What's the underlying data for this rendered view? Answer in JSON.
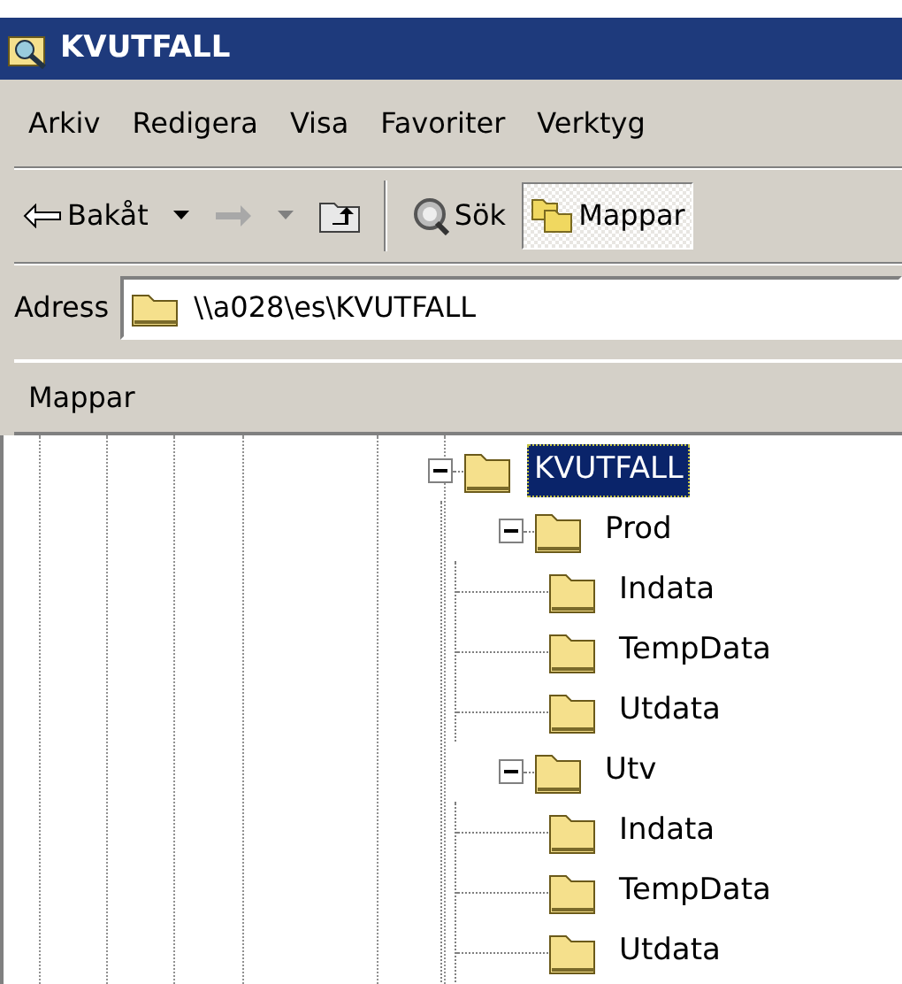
{
  "window": {
    "title": "KVUTFALL"
  },
  "menu": [
    "Arkiv",
    "Redigera",
    "Visa",
    "Favoriter",
    "Verktyg"
  ],
  "toolbar": [
    {
      "kind": "back",
      "label": "Bakåt",
      "disabled": false
    },
    {
      "kind": "forward",
      "disabled": true
    },
    {
      "kind": "up"
    },
    {
      "kind": "search",
      "label": "Sök",
      "selected": false
    },
    {
      "kind": "folders",
      "label": "Mappar",
      "selected": true
    }
  ],
  "address": {
    "label": "Adress",
    "value": "\\\\a028\\es\\KVUTFALL"
  },
  "panel": {
    "title": "Mappar"
  },
  "tree": [
    {
      "label": "KVUTFALL",
      "expanded": true,
      "selected": true,
      "children": [
        {
          "label": "Prod",
          "expanded": true,
          "selected": false,
          "children": [
            {
              "label": "Indata",
              "selected": false
            },
            {
              "label": "TempData",
              "selected": false
            },
            {
              "label": "Utdata",
              "selected": false
            }
          ]
        },
        {
          "label": "Utv",
          "expanded": true,
          "selected": false,
          "children": [
            {
              "label": "Indata",
              "selected": false
            },
            {
              "label": "TempData",
              "selected": false
            },
            {
              "label": "Utdata",
              "selected": false
            }
          ]
        }
      ]
    }
  ]
}
